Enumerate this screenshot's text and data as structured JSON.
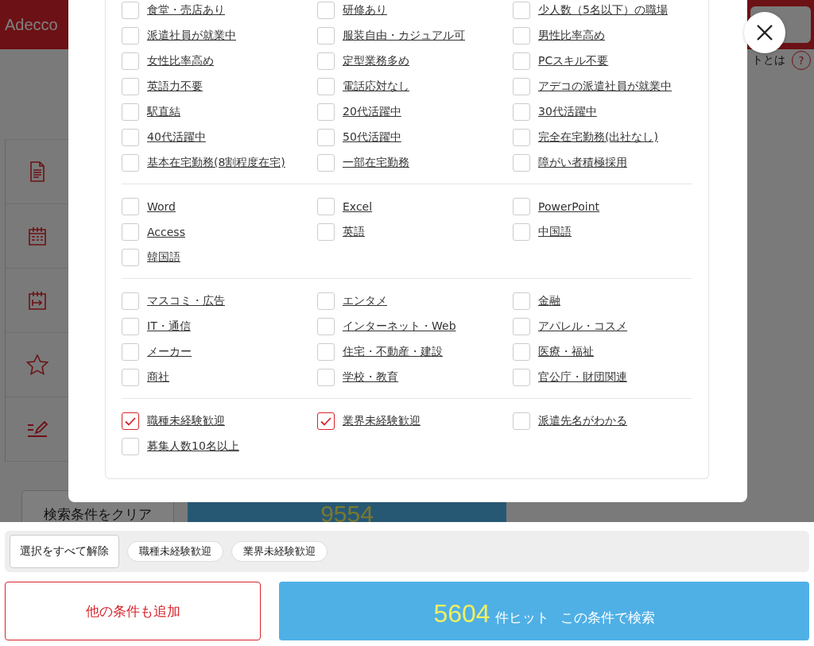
{
  "background": {
    "logo": "Adecco",
    "help_text": "トとは",
    "help_icon": "?",
    "clear_button": "検索条件をクリア",
    "hit_count": "9554"
  },
  "sections": [
    {
      "items": [
        {
          "label": "食堂・売店あり",
          "checked": false
        },
        {
          "label": "研修あり",
          "checked": false
        },
        {
          "label": "少人数（5名以下）の職場",
          "checked": false
        },
        {
          "label": "派遣社員が就業中",
          "checked": false
        },
        {
          "label": "服装自由・カジュアル可",
          "checked": false
        },
        {
          "label": "男性比率高め",
          "checked": false
        },
        {
          "label": "女性比率高め",
          "checked": false
        },
        {
          "label": "定型業務多め",
          "checked": false
        },
        {
          "label": "PCスキル不要",
          "checked": false
        },
        {
          "label": "英語力不要",
          "checked": false
        },
        {
          "label": "電話応対なし",
          "checked": false
        },
        {
          "label": "アデコの派遣社員が就業中",
          "checked": false
        },
        {
          "label": "駅直結",
          "checked": false
        },
        {
          "label": "20代活躍中",
          "checked": false
        },
        {
          "label": "30代活躍中",
          "checked": false
        },
        {
          "label": "40代活躍中",
          "checked": false
        },
        {
          "label": "50代活躍中",
          "checked": false
        },
        {
          "label": "完全在宅勤務(出社なし)",
          "checked": false
        },
        {
          "label": "基本在宅勤務(8割程度在宅)",
          "checked": false
        },
        {
          "label": "一部在宅勤務",
          "checked": false
        },
        {
          "label": "障がい者積極採用",
          "checked": false
        }
      ]
    },
    {
      "items": [
        {
          "label": "Word",
          "checked": false
        },
        {
          "label": "Excel",
          "checked": false
        },
        {
          "label": "PowerPoint",
          "checked": false
        },
        {
          "label": "Access",
          "checked": false
        },
        {
          "label": "英語",
          "checked": false
        },
        {
          "label": "中国語",
          "checked": false
        },
        {
          "label": "韓国語",
          "checked": false
        }
      ]
    },
    {
      "items": [
        {
          "label": "マスコミ・広告",
          "checked": false
        },
        {
          "label": "エンタメ",
          "checked": false
        },
        {
          "label": "金融",
          "checked": false
        },
        {
          "label": "IT・通信",
          "checked": false
        },
        {
          "label": "インターネット・Web",
          "checked": false
        },
        {
          "label": "アパレル・コスメ",
          "checked": false
        },
        {
          "label": "メーカー",
          "checked": false
        },
        {
          "label": "住宅・不動産・建設",
          "checked": false
        },
        {
          "label": "医療・福祉",
          "checked": false
        },
        {
          "label": "商社",
          "checked": false
        },
        {
          "label": "学校・教育",
          "checked": false
        },
        {
          "label": "官公庁・財団関連",
          "checked": false
        }
      ]
    },
    {
      "items": [
        {
          "label": "職種未経験歓迎",
          "checked": true
        },
        {
          "label": "業界未経験歓迎",
          "checked": true
        },
        {
          "label": "派遣先名がわかる",
          "checked": false
        },
        {
          "label": "募集人数10名以上",
          "checked": false
        }
      ]
    }
  ],
  "selection_bar": {
    "clear_all": "選択をすべて解除",
    "chips": [
      "職種未経験歓迎",
      "業界未経験歓迎"
    ]
  },
  "add_button": "他の条件も追加",
  "search_button": {
    "count": "5604",
    "suffix": "件ヒット",
    "label": "この条件で検索"
  }
}
